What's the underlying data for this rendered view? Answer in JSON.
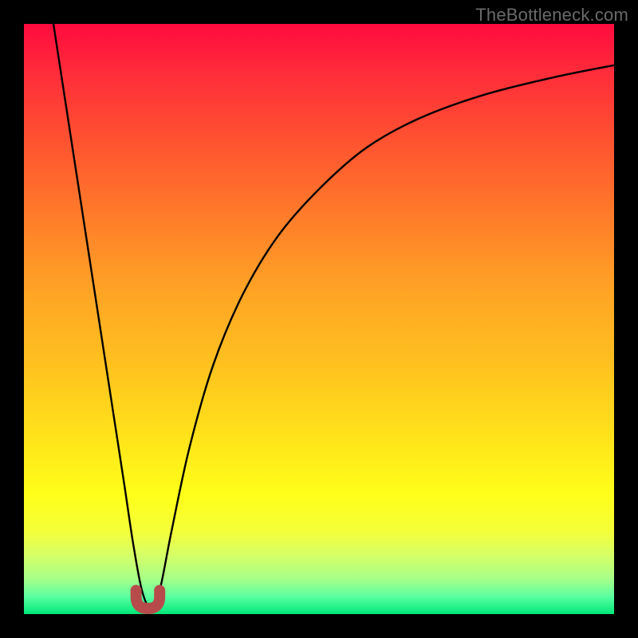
{
  "watermark": "TheBottleneck.com",
  "colors": {
    "frame": "#000000",
    "gradient_top": "#ff0b3e",
    "gradient_bottom": "#00e87a",
    "curve": "#000000",
    "marker": "#b74b4b"
  },
  "chart_data": {
    "type": "line",
    "title": "",
    "xlabel": "",
    "ylabel": "",
    "xlim": [
      0,
      100
    ],
    "ylim": [
      0,
      100
    ],
    "series": [
      {
        "name": "curve",
        "x": [
          5,
          7,
          9,
          11,
          13,
          15,
          17,
          18.5,
          20,
          21.5,
          23,
          25,
          28,
          32,
          37,
          43,
          50,
          58,
          67,
          78,
          90,
          100
        ],
        "values": [
          100,
          87,
          74,
          61,
          48,
          35,
          22,
          12,
          4,
          1,
          4,
          14,
          28,
          42,
          54,
          64,
          72,
          79,
          84,
          88,
          91,
          93
        ]
      }
    ],
    "marker": {
      "shape": "U",
      "x_range": [
        19,
        23
      ],
      "y_range": [
        0,
        4
      ],
      "color": "#b74b4b"
    },
    "grid": false,
    "legend": false
  }
}
